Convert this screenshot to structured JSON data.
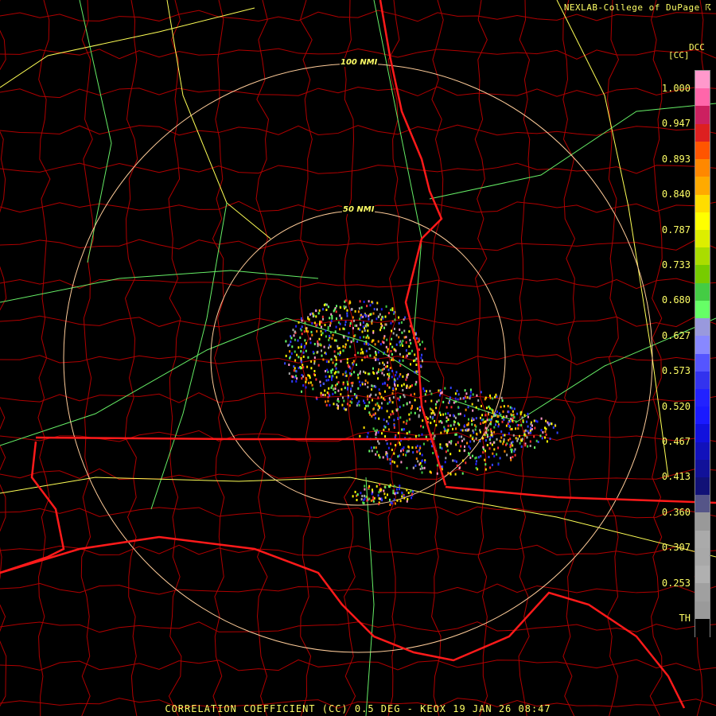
{
  "header": {
    "credit": "NEXLAB-College of DuPage ☈"
  },
  "legend": {
    "product_code": "DCC",
    "unit": "[CC]",
    "ticks": [
      "1.000",
      "0.947",
      "0.893",
      "0.840",
      "0.787",
      "0.733",
      "0.680",
      "0.627",
      "0.573",
      "0.520",
      "0.467",
      "0.413",
      "0.360",
      "0.307",
      "0.253",
      "TH"
    ],
    "colors": [
      "#ff99cc",
      "#ff66aa",
      "#cc2060",
      "#dd2020",
      "#ff5500",
      "#ff8800",
      "#ffaa00",
      "#ffdd00",
      "#ffff00",
      "#ddee00",
      "#aadd00",
      "#77cc00",
      "#44cc44",
      "#66ff66",
      "#9999dd",
      "#8888ff",
      "#5555ff",
      "#3333ee",
      "#2222ff",
      "#1a1aff",
      "#1111dd",
      "#1111bb",
      "#111199",
      "#111177",
      "#555588",
      "#999999",
      "#aaaaaa",
      "#a8a8a8",
      "#b0b0b0",
      "#a0a0a0",
      "#9a9a9a",
      "#000000"
    ]
  },
  "map": {
    "range_rings": [
      "100 NMI",
      "50 NMI"
    ],
    "colors": {
      "counties": "#b00000",
      "states": "#ff1a1a",
      "interstates": "#ffff55",
      "highways": "#66ee66",
      "rings": "#ffcc99"
    }
  },
  "footer": {
    "product": "CORRELATION COEFFICIENT (CC) 0.5 DEG - KEOX 19 JAN 26 08:47"
  }
}
